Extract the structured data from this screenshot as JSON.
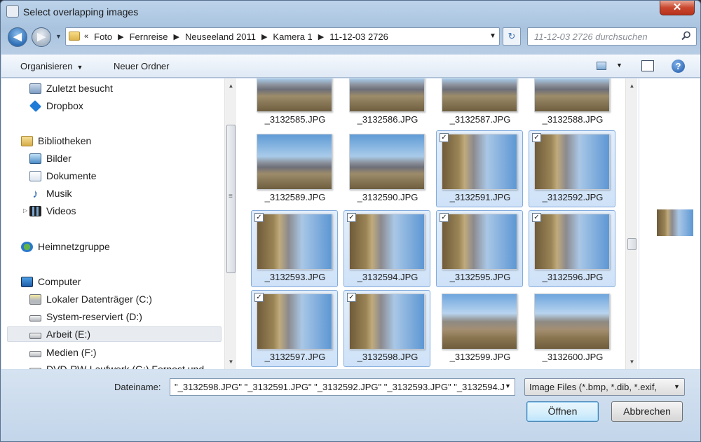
{
  "window": {
    "title": "Select overlapping images",
    "close_label": "✕"
  },
  "nav": {
    "back_glyph": "◀",
    "forward_glyph": "▶",
    "history_caret": "▼"
  },
  "address": {
    "lead": "«",
    "crumbs": [
      "Foto",
      "Fernreise",
      "Neuseeland 2011",
      "Kamera 1",
      "11-12-03 2726"
    ],
    "separator": "▶",
    "dropdown": "▼",
    "refresh_glyph": "↻"
  },
  "search": {
    "placeholder": "11-12-03 2726 durchsuchen",
    "icon": "search-icon"
  },
  "toolbar": {
    "organize_label": "Organisieren",
    "organize_caret": "▼",
    "new_folder_label": "Neuer Ordner",
    "view_caret": "▼",
    "help_glyph": "?"
  },
  "sidebar": {
    "items": [
      {
        "label": "Zuletzt besucht",
        "icon": "recent-places-icon"
      },
      {
        "label": "Dropbox",
        "icon": "dropbox-icon"
      },
      {
        "label": "Bibliotheken",
        "icon": "libraries-icon"
      },
      {
        "label": "Bilder",
        "icon": "pictures-icon"
      },
      {
        "label": "Dokumente",
        "icon": "documents-icon"
      },
      {
        "label": "Musik",
        "icon": "music-icon"
      },
      {
        "label": "Videos",
        "icon": "videos-icon"
      },
      {
        "label": "Heimnetzgruppe",
        "icon": "homegroup-icon"
      },
      {
        "label": "Computer",
        "icon": "computer-icon"
      },
      {
        "label": "Lokaler Datenträger (C:)",
        "icon": "drive-icon"
      },
      {
        "label": "System-reserviert (D:)",
        "icon": "drive-icon"
      },
      {
        "label": "Arbeit (E:)",
        "icon": "drive-icon",
        "selected": true
      },
      {
        "label": "Medien (F:)",
        "icon": "drive-icon"
      },
      {
        "label": "DVD-RW-Laufwerk (G:) Fernost und",
        "icon": "dvd-drive-icon"
      }
    ],
    "expander_glyph": "▷",
    "music_glyph": "♪"
  },
  "files": [
    {
      "name": "_3132585.JPG",
      "selected": false,
      "kind": "landscape"
    },
    {
      "name": "_3132586.JPG",
      "selected": false,
      "kind": "landscape"
    },
    {
      "name": "_3132587.JPG",
      "selected": false,
      "kind": "landscape"
    },
    {
      "name": "_3132588.JPG",
      "selected": false,
      "kind": "landscape"
    },
    {
      "name": "_3132589.JPG",
      "selected": false,
      "kind": "landscape"
    },
    {
      "name": "_3132590.JPG",
      "selected": false,
      "kind": "landscape"
    },
    {
      "name": "_3132591.JPG",
      "selected": true,
      "kind": "rotated"
    },
    {
      "name": "_3132592.JPG",
      "selected": true,
      "kind": "rotated"
    },
    {
      "name": "_3132593.JPG",
      "selected": true,
      "kind": "rotated"
    },
    {
      "name": "_3132594.JPG",
      "selected": true,
      "kind": "rotated"
    },
    {
      "name": "_3132595.JPG",
      "selected": true,
      "kind": "rotated"
    },
    {
      "name": "_3132596.JPG",
      "selected": true,
      "kind": "rotated"
    },
    {
      "name": "_3132597.JPG",
      "selected": true,
      "kind": "rotated"
    },
    {
      "name": "_3132598.JPG",
      "selected": true,
      "kind": "rotated"
    },
    {
      "name": "_3132599.JPG",
      "selected": false,
      "kind": "mountain"
    },
    {
      "name": "_3132600.JPG",
      "selected": false,
      "kind": "mountain"
    }
  ],
  "checkbox_glyph": "✓",
  "scroll": {
    "up": "▲",
    "down": "▼",
    "grip": "≡"
  },
  "footer": {
    "filename_label": "Dateiname:",
    "filename_value": "\"_3132598.JPG\" \"_3132591.JPG\" \"_3132592.JPG\" \"_3132593.JPG\" \"_3132594.J",
    "filename_caret": "▼",
    "filter_value": "Image Files (*.bmp, *.dib, *.exif,",
    "filter_caret": "▼",
    "open_label": "Öffnen",
    "cancel_label": "Abbrechen"
  }
}
